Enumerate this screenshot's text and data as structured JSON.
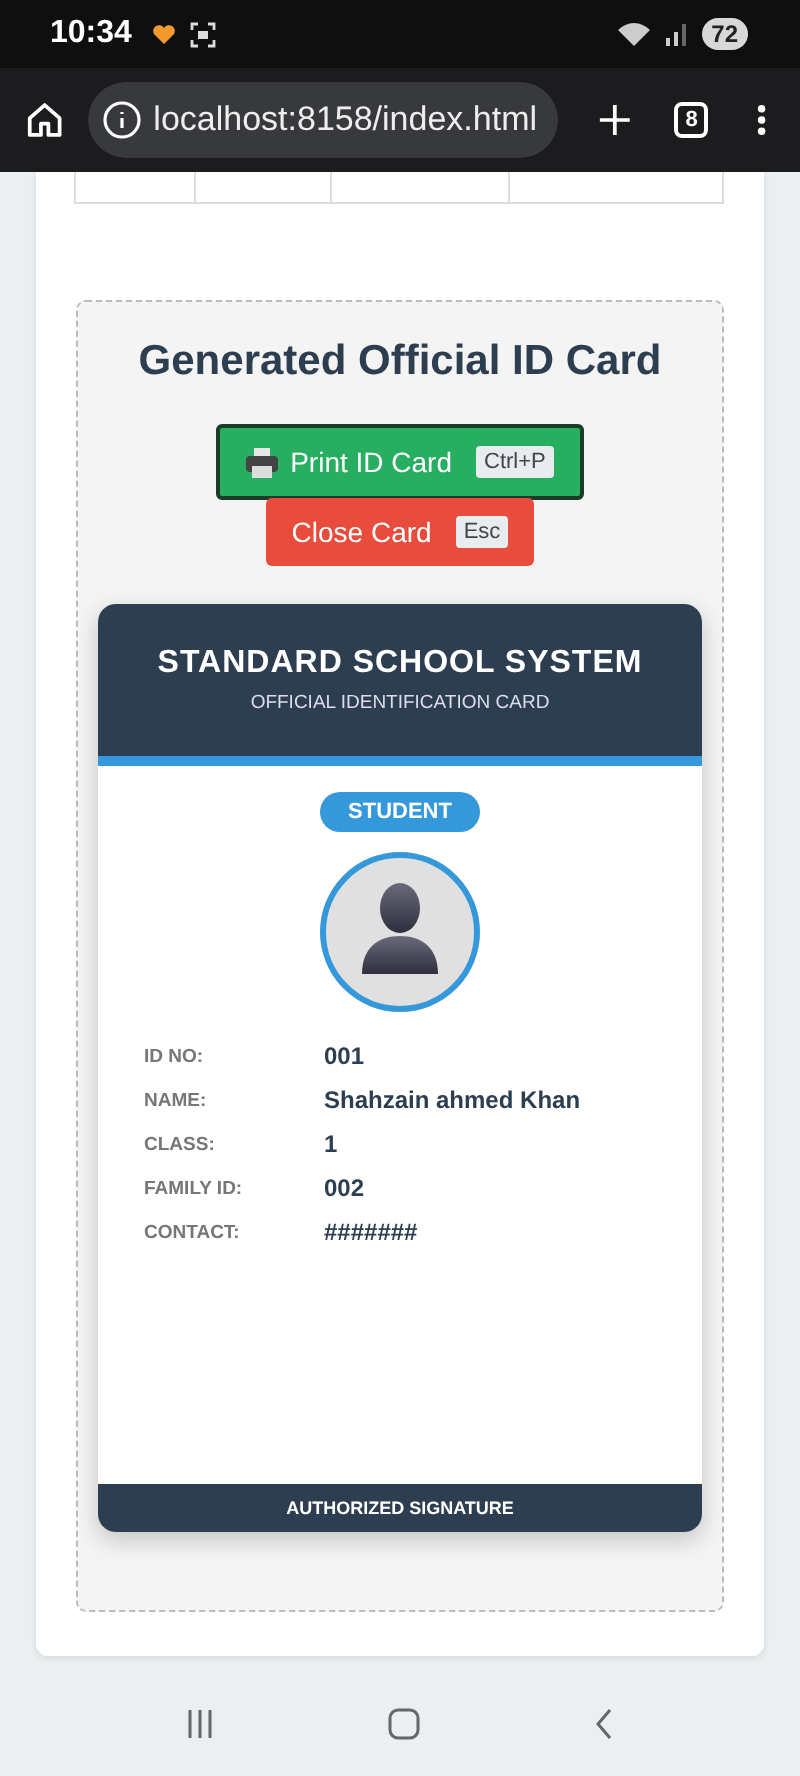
{
  "status_bar": {
    "time": "10:34",
    "battery": "72"
  },
  "browser": {
    "url": "localhost:8158/index.html",
    "tab_count": "8"
  },
  "section": {
    "title": "Generated Official ID Card",
    "buttons": [
      {
        "kind": "print",
        "label": "Print ID Card",
        "shortcut": "Ctrl+P"
      },
      {
        "kind": "close",
        "label": "Close Card",
        "shortcut": "Esc"
      }
    ]
  },
  "id_card": {
    "school": "STANDARD SCHOOL SYSTEM",
    "subtitle": "OFFICIAL IDENTIFICATION CARD",
    "role": "STUDENT",
    "fields": [
      {
        "label": "ID NO:",
        "value": "001"
      },
      {
        "label": "NAME:",
        "value": "Shahzain ahmed Khan"
      },
      {
        "label": "CLASS:",
        "value": "1"
      },
      {
        "label": "FAMILY ID:",
        "value": "002"
      },
      {
        "label": "CONTACT:",
        "value": "#######"
      }
    ],
    "footer": "AUTHORIZED SIGNATURE"
  }
}
